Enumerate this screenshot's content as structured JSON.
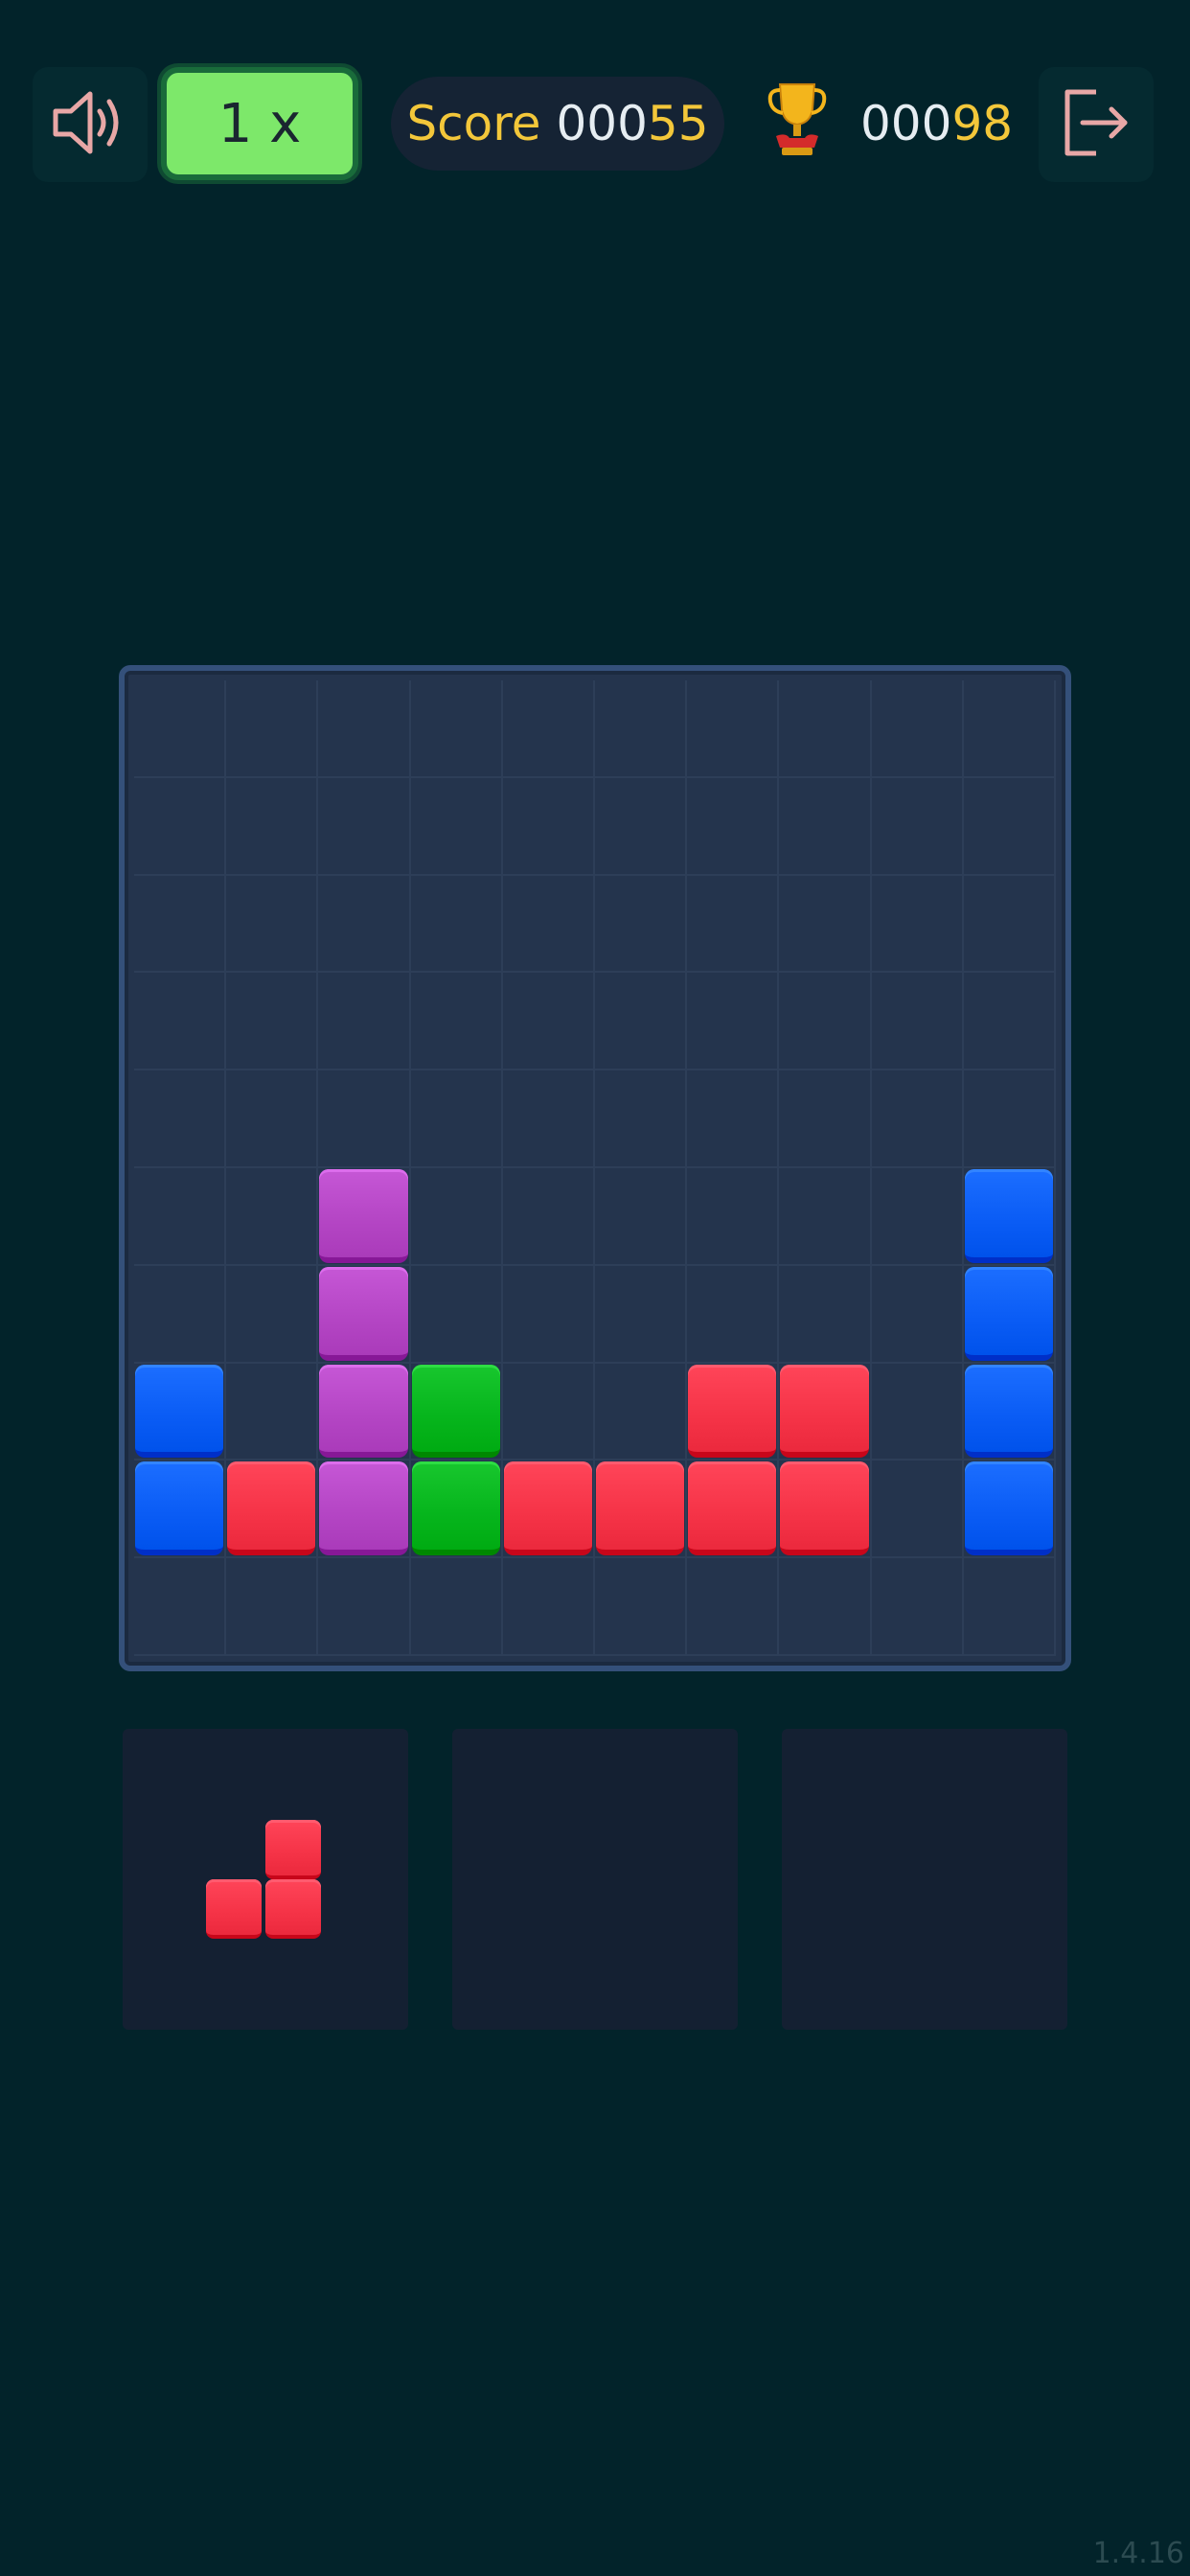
{
  "header": {
    "speed_label": "1 x",
    "score_label": "Score",
    "score_prefix": "000",
    "score_value": "55",
    "best_prefix": "000",
    "best_value": "98",
    "sound_icon": "speaker-icon",
    "trophy_icon": "trophy-icon",
    "exit_icon": "exit-icon"
  },
  "colors": {
    "blue": "#0a5cf5",
    "red": "#f53347",
    "purple": "#b445c4",
    "green": "#06b51c",
    "accent_yellow": "#f3c73a",
    "speed_green": "#7de86a"
  },
  "board": {
    "rows": 10,
    "cols": 10,
    "filled": [
      {
        "row": 5,
        "col": 2,
        "color": "purple"
      },
      {
        "row": 5,
        "col": 9,
        "color": "blue"
      },
      {
        "row": 6,
        "col": 2,
        "color": "purple"
      },
      {
        "row": 6,
        "col": 9,
        "color": "blue"
      },
      {
        "row": 7,
        "col": 0,
        "color": "blue"
      },
      {
        "row": 7,
        "col": 2,
        "color": "purple"
      },
      {
        "row": 7,
        "col": 3,
        "color": "green"
      },
      {
        "row": 7,
        "col": 6,
        "color": "red"
      },
      {
        "row": 7,
        "col": 7,
        "color": "red"
      },
      {
        "row": 7,
        "col": 9,
        "color": "blue"
      },
      {
        "row": 8,
        "col": 0,
        "color": "blue"
      },
      {
        "row": 8,
        "col": 1,
        "color": "red"
      },
      {
        "row": 8,
        "col": 2,
        "color": "purple"
      },
      {
        "row": 8,
        "col": 3,
        "color": "green"
      },
      {
        "row": 8,
        "col": 4,
        "color": "red"
      },
      {
        "row": 8,
        "col": 5,
        "color": "red"
      },
      {
        "row": 8,
        "col": 6,
        "color": "red"
      },
      {
        "row": 8,
        "col": 7,
        "color": "red"
      },
      {
        "row": 8,
        "col": 9,
        "color": "blue"
      }
    ]
  },
  "pieces": [
    {
      "color": "red",
      "cells": [
        {
          "row": 0,
          "col": 1
        },
        {
          "row": 1,
          "col": 0
        },
        {
          "row": 1,
          "col": 1
        }
      ]
    },
    null,
    null
  ],
  "version": "1.4.16"
}
